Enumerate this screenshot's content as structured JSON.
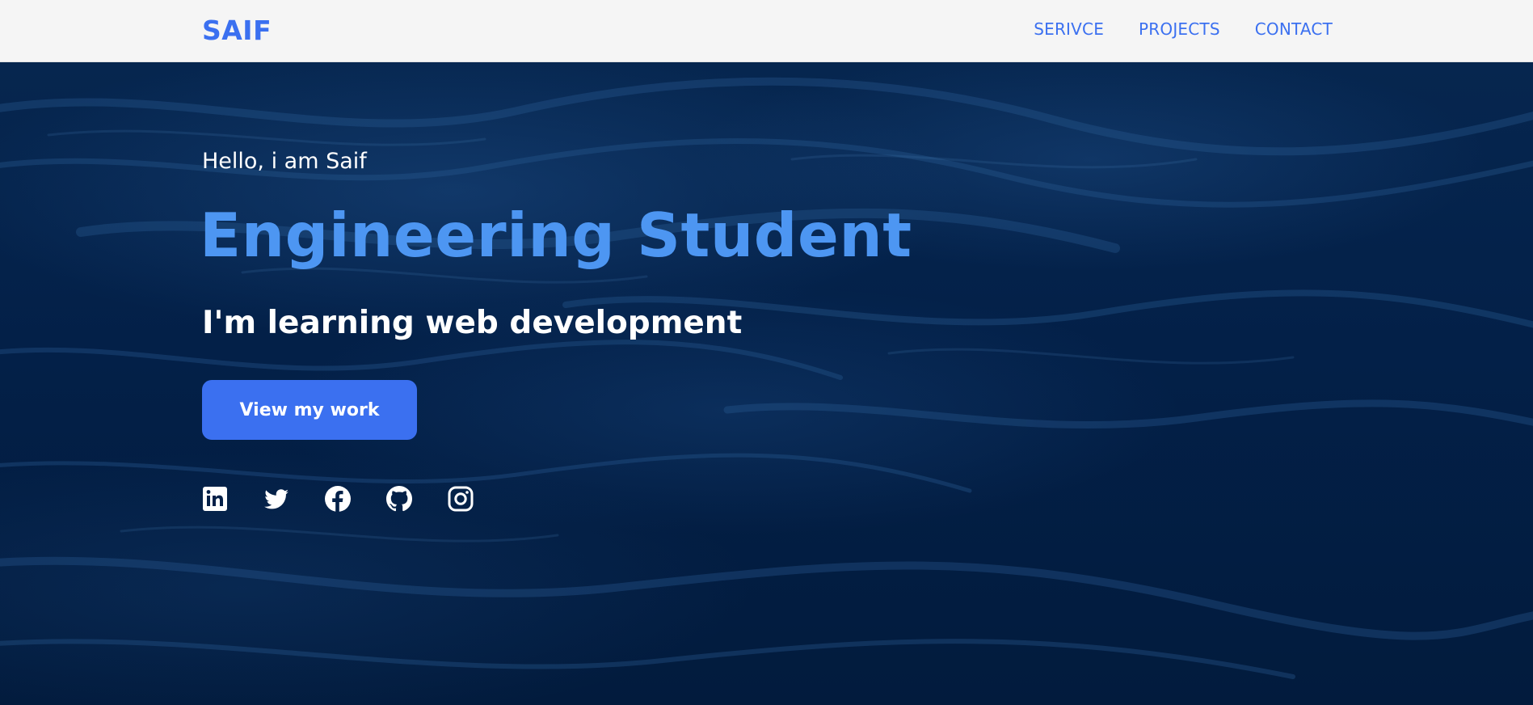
{
  "nav": {
    "logo": "SAIF",
    "links": [
      {
        "label": "SERIVCE"
      },
      {
        "label": "PROJECTS"
      },
      {
        "label": "CONTACT"
      }
    ]
  },
  "hero": {
    "greeting": "Hello, i am Saif",
    "headline": "Engineering Student",
    "subheadline": "I'm learning web development",
    "cta_label": "View my work",
    "social_icons": [
      "linkedin-icon",
      "twitter-icon",
      "facebook-icon",
      "github-icon",
      "instagram-icon"
    ]
  },
  "colors": {
    "accent": "#3b70f0",
    "headline": "#4d96f2",
    "hero_background": "#021b3d",
    "navbar_background": "#f5f5f5",
    "text_light": "#ffffff"
  }
}
